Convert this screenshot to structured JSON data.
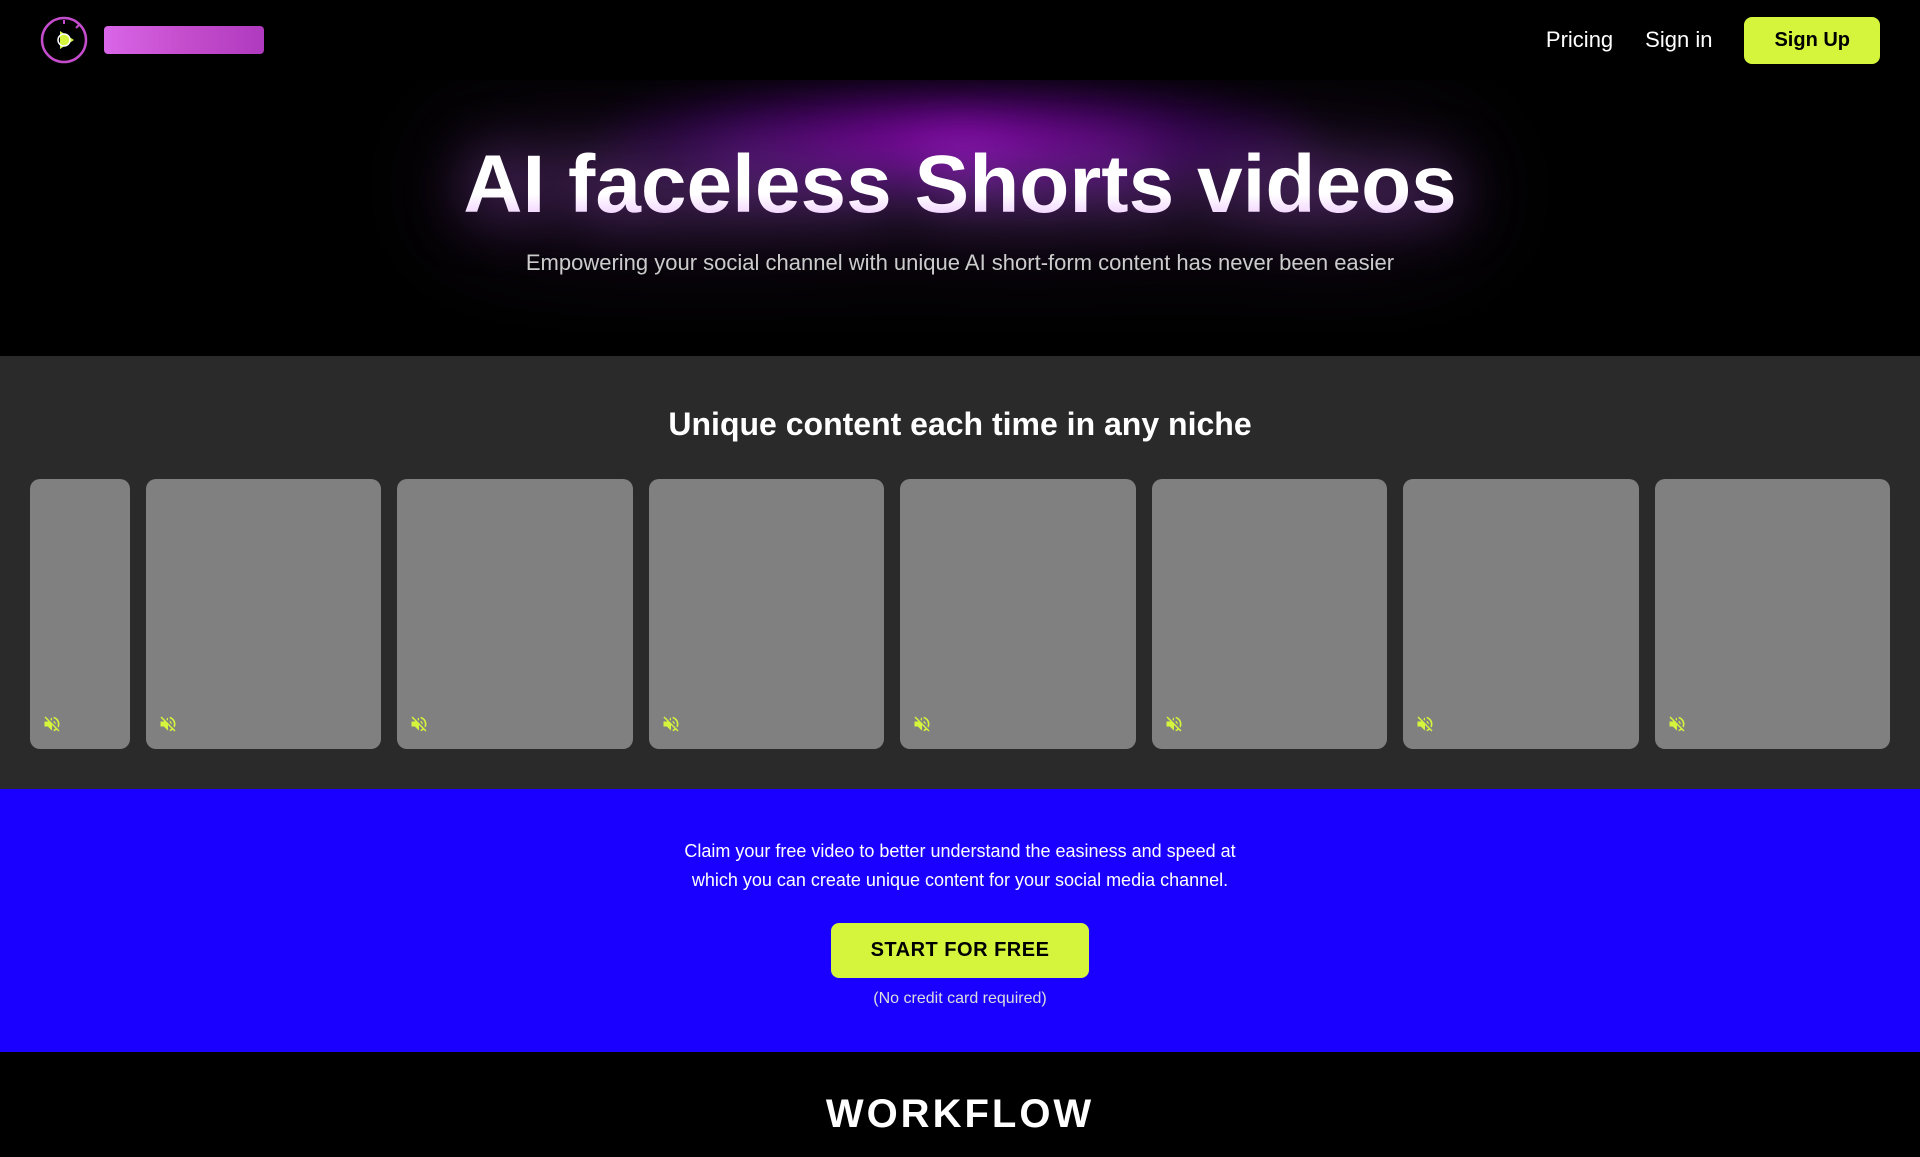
{
  "nav": {
    "pricing_label": "Pricing",
    "signin_label": "Sign in",
    "signup_label": "Sign Up"
  },
  "hero": {
    "title": "AI faceless Shorts videos",
    "subtitle": "Empowering your social channel with unique AI short-form content has never been easier"
  },
  "video_section": {
    "title": "Unique content each time in any niche",
    "cards": [
      {
        "id": 1,
        "muted": true
      },
      {
        "id": 2,
        "muted": true
      },
      {
        "id": 3,
        "muted": true
      },
      {
        "id": 4,
        "muted": true
      },
      {
        "id": 5,
        "muted": true
      },
      {
        "id": 6,
        "muted": true
      },
      {
        "id": 7,
        "muted": true
      },
      {
        "id": 8,
        "muted": true
      }
    ]
  },
  "cta_banner": {
    "text_line1": "Claim your free video to better understand the easiness and speed at",
    "text_line2": "which you can create unique content for your social media channel.",
    "button_label": "START FOR FREE",
    "no_cc_label": "(No credit card required)"
  },
  "workflow": {
    "title": "WORKFLOW"
  }
}
